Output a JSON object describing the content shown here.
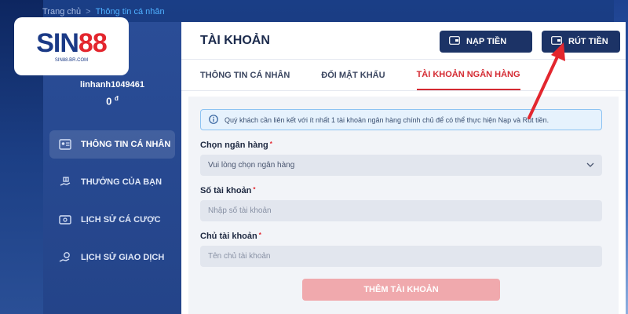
{
  "breadcrumb": {
    "home": "Trang chủ",
    "separator": ">",
    "current": "Thông tin cá nhân"
  },
  "logo": {
    "text_main": "SIN",
    "text_accent": "88",
    "subtext": "SIN88.BR.COM"
  },
  "user": {
    "username": "linhanh1049461",
    "balance": "0",
    "currency": "đ"
  },
  "sidebar": {
    "items": [
      {
        "label": "THÔNG TIN CÁ NHÂN",
        "icon": "id-card-icon",
        "active": true
      },
      {
        "label": "THƯỞNG CỦA BẠN",
        "icon": "gift-hand-icon",
        "active": false
      },
      {
        "label": "LỊCH SỬ CÁ CƯỢC",
        "icon": "ticket-icon",
        "active": false
      },
      {
        "label": "LỊCH SỬ GIAO DỊCH",
        "icon": "money-hand-icon",
        "active": false
      }
    ]
  },
  "panel": {
    "title": "TÀI KHOẢN",
    "deposit_label": "NẠP TIỀN",
    "withdraw_label": "RÚT TIỀN",
    "tabs": [
      {
        "label": "THÔNG TIN CÁ NHÂN",
        "active": false
      },
      {
        "label": "ĐỔI MẬT KHẨU",
        "active": false
      },
      {
        "label": "TÀI KHOẢN NGÂN HÀNG",
        "active": true
      }
    ]
  },
  "form": {
    "notice": "Quý khách cần liên kết với ít nhất 1 tài khoản ngân hàng chính chủ để có thể thực hiện Nạp và Rút tiền.",
    "bank_label": "Chọn ngân hàng",
    "bank_value": "Vui lòng chọn ngân hàng",
    "account_number_label": "Số tài khoản",
    "account_number_placeholder": "Nhập số tài khoản",
    "account_holder_label": "Chủ tài khoản",
    "account_holder_placeholder": "Tên chủ tài khoản",
    "required_mark": "*",
    "submit_label": "THÊM TÀI KHOẢN"
  },
  "colors": {
    "primary_navy": "#1c3366",
    "accent_red": "#d42a32",
    "sidebar_blue": "#2a4d97",
    "info_blue": "#8dc3f2",
    "disabled_button": "#f0a9ad"
  }
}
